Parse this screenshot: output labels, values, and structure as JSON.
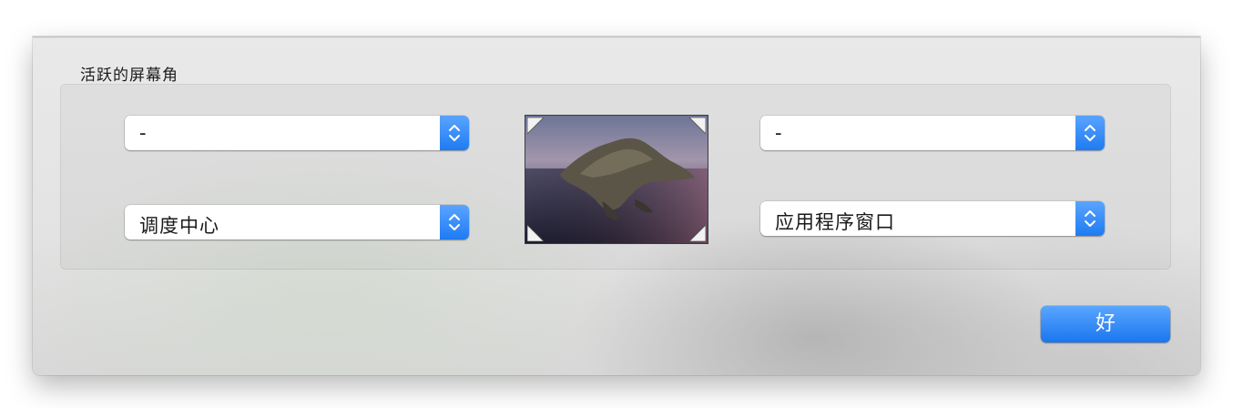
{
  "dialog": {
    "section_title": "活跃的屏幕角",
    "ok_label": "好"
  },
  "corners": {
    "top_left": {
      "selected": "-"
    },
    "top_right": {
      "selected": "-"
    },
    "bottom_left": {
      "selected": "调度中心"
    },
    "bottom_right": {
      "selected": "应用程序窗口"
    }
  },
  "colors": {
    "accent": "#1f7bf2",
    "sheet_background": "#e6e6e6",
    "text": "#1a1a1a"
  },
  "icons": {
    "popup_indicator": "up-down-chevron-icon",
    "corner_marker": "corner-triangle-icon",
    "preview": "desktop-wallpaper-thumbnail"
  }
}
